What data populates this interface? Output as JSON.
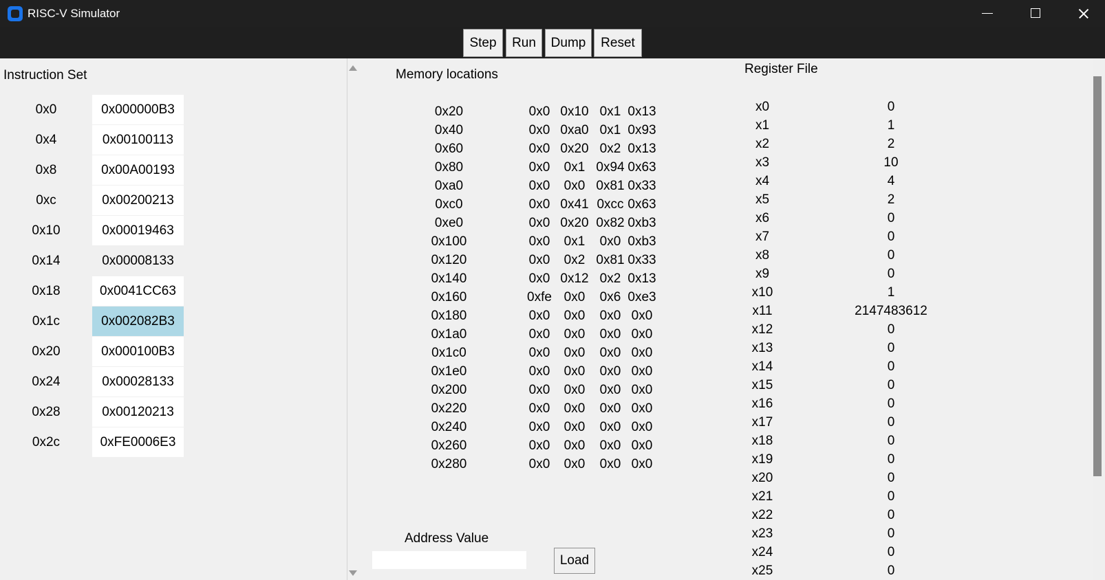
{
  "window": {
    "title": "RISC-V Simulator",
    "controls": [
      "minimize",
      "maximize",
      "close"
    ],
    "colors": {
      "title_bar": "#202020",
      "toolbar": "#1f1f1f",
      "panel": "#f0f0f0",
      "selected_instruction": "#add8e6"
    }
  },
  "toolbar": {
    "buttons": [
      {
        "label": "Step",
        "icon": "step"
      },
      {
        "label": "Run",
        "icon": "run"
      },
      {
        "label": "Dump",
        "icon": "dump"
      },
      {
        "label": "Reset",
        "icon": "reset"
      }
    ]
  },
  "instruction_set": {
    "heading": "Instruction Set",
    "rows": [
      {
        "address": "0x0",
        "instruction": "0x000000B3"
      },
      {
        "address": "0x4",
        "instruction": "0x00100113"
      },
      {
        "address": "0x8",
        "instruction": "0x00A00193"
      },
      {
        "address": "0xc",
        "instruction": "0x00200213"
      },
      {
        "address": "0x10",
        "instruction": "0x00019463"
      },
      {
        "address": "0x14",
        "instruction": "0x00008133"
      },
      {
        "address": "0x18",
        "instruction": "0x0041CC63"
      },
      {
        "address": "0x1c",
        "instruction": "0x002082B3"
      },
      {
        "address": "0x20",
        "instruction": "0x000100B3"
      },
      {
        "address": "0x24",
        "instruction": "0x00028133"
      },
      {
        "address": "0x28",
        "instruction": "0x00120213"
      },
      {
        "address": "0x2c",
        "instruction": "0xFE0006E3"
      }
    ],
    "selected_address": "0x1c"
  },
  "memory": {
    "heading": "Memory locations",
    "rows": [
      {
        "address": "0x20",
        "bytes": [
          "0x0",
          "0x10",
          "0x1",
          "0x13"
        ]
      },
      {
        "address": "0x40",
        "bytes": [
          "0x0",
          "0xa0",
          "0x1",
          "0x93"
        ]
      },
      {
        "address": "0x60",
        "bytes": [
          "0x0",
          "0x20",
          "0x2",
          "0x13"
        ]
      },
      {
        "address": "0x80",
        "bytes": [
          "0x0",
          "0x1",
          "0x94",
          "0x63"
        ]
      },
      {
        "address": "0xa0",
        "bytes": [
          "0x0",
          "0x0",
          "0x81",
          "0x33"
        ]
      },
      {
        "address": "0xc0",
        "bytes": [
          "0x0",
          "0x41",
          "0xcc",
          "0x63"
        ]
      },
      {
        "address": "0xe0",
        "bytes": [
          "0x0",
          "0x20",
          "0x82",
          "0xb3"
        ]
      },
      {
        "address": "0x100",
        "bytes": [
          "0x0",
          "0x1",
          "0x0",
          "0xb3"
        ]
      },
      {
        "address": "0x120",
        "bytes": [
          "0x0",
          "0x2",
          "0x81",
          "0x33"
        ]
      },
      {
        "address": "0x140",
        "bytes": [
          "0x0",
          "0x12",
          "0x2",
          "0x13"
        ]
      },
      {
        "address": "0x160",
        "bytes": [
          "0xfe",
          "0x0",
          "0x6",
          "0xe3"
        ]
      },
      {
        "address": "0x180",
        "bytes": [
          "0x0",
          "0x0",
          "0x0",
          "0x0"
        ]
      },
      {
        "address": "0x1a0",
        "bytes": [
          "0x0",
          "0x0",
          "0x0",
          "0x0"
        ]
      },
      {
        "address": "0x1c0",
        "bytes": [
          "0x0",
          "0x0",
          "0x0",
          "0x0"
        ]
      },
      {
        "address": "0x1e0",
        "bytes": [
          "0x0",
          "0x0",
          "0x0",
          "0x0"
        ]
      },
      {
        "address": "0x200",
        "bytes": [
          "0x0",
          "0x0",
          "0x0",
          "0x0"
        ]
      },
      {
        "address": "0x220",
        "bytes": [
          "0x0",
          "0x0",
          "0x0",
          "0x0"
        ]
      },
      {
        "address": "0x240",
        "bytes": [
          "0x0",
          "0x0",
          "0x0",
          "0x0"
        ]
      },
      {
        "address": "0x260",
        "bytes": [
          "0x0",
          "0x0",
          "0x0",
          "0x0"
        ]
      },
      {
        "address": "0x280",
        "bytes": [
          "0x0",
          "0x0",
          "0x0",
          "0x0"
        ]
      }
    ],
    "address_value_label": "Address Value",
    "address_input_value": "",
    "load_label": "Load"
  },
  "register_file": {
    "heading": "Register File",
    "rows": [
      {
        "name": "x0",
        "value": "0"
      },
      {
        "name": "x1",
        "value": "1"
      },
      {
        "name": "x2",
        "value": "2"
      },
      {
        "name": "x3",
        "value": "10"
      },
      {
        "name": "x4",
        "value": "4"
      },
      {
        "name": "x5",
        "value": "2"
      },
      {
        "name": "x6",
        "value": "0"
      },
      {
        "name": "x7",
        "value": "0"
      },
      {
        "name": "x8",
        "value": "0"
      },
      {
        "name": "x9",
        "value": "0"
      },
      {
        "name": "x10",
        "value": "1"
      },
      {
        "name": "x11",
        "value": "2147483612"
      },
      {
        "name": "x12",
        "value": "0"
      },
      {
        "name": "x13",
        "value": "0"
      },
      {
        "name": "x14",
        "value": "0"
      },
      {
        "name": "x15",
        "value": "0"
      },
      {
        "name": "x16",
        "value": "0"
      },
      {
        "name": "x17",
        "value": "0"
      },
      {
        "name": "x18",
        "value": "0"
      },
      {
        "name": "x19",
        "value": "0"
      },
      {
        "name": "x20",
        "value": "0"
      },
      {
        "name": "x21",
        "value": "0"
      },
      {
        "name": "x22",
        "value": "0"
      },
      {
        "name": "x23",
        "value": "0"
      },
      {
        "name": "x24",
        "value": "0"
      },
      {
        "name": "x25",
        "value": "0"
      }
    ]
  }
}
